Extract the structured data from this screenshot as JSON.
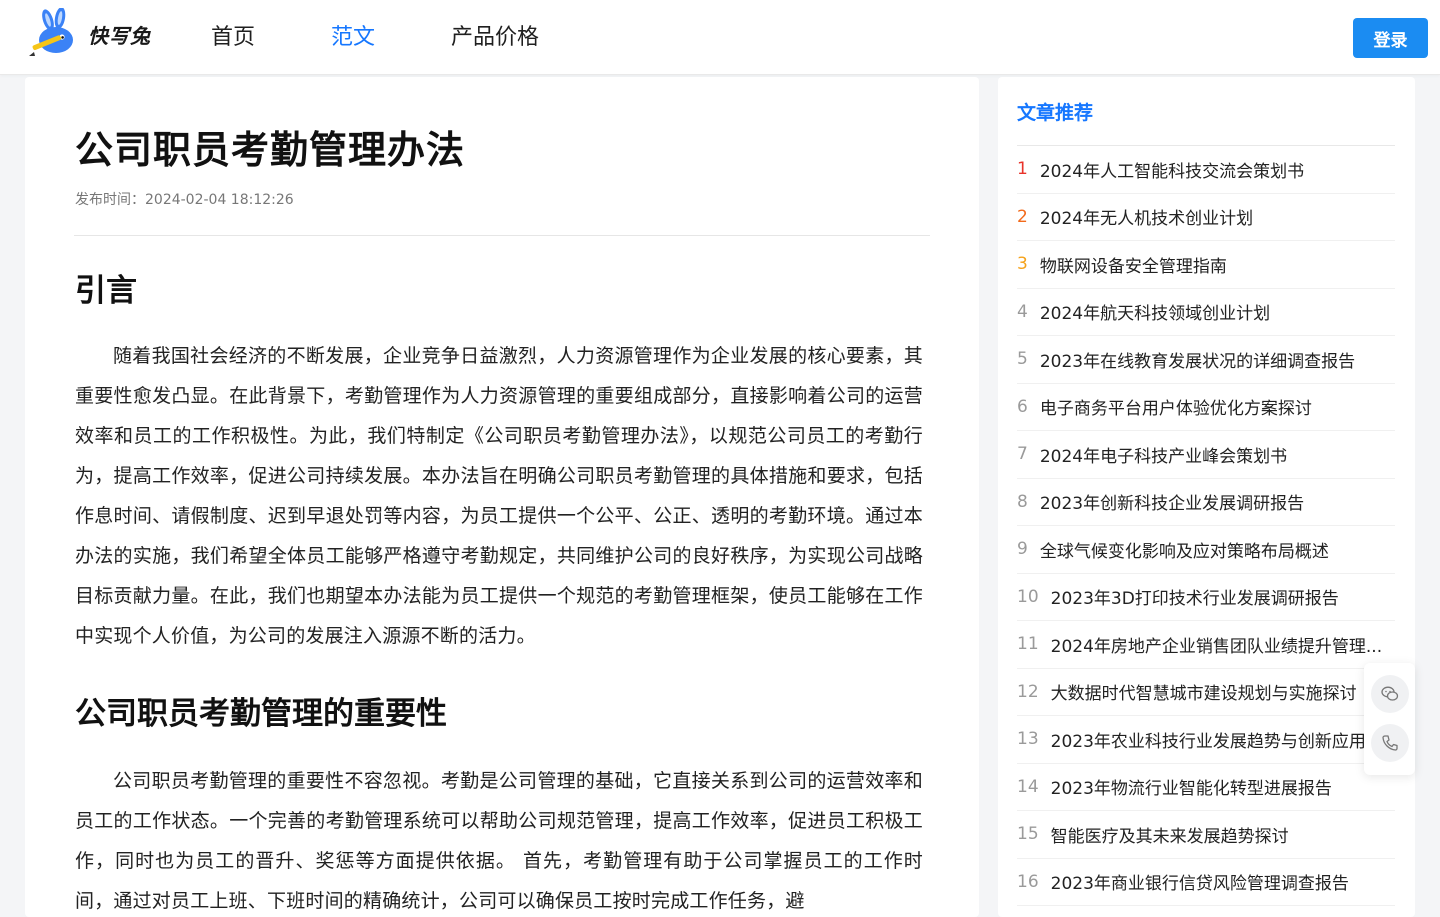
{
  "header": {
    "logo_text": "快写兔",
    "nav": [
      {
        "label": "首页",
        "active": false
      },
      {
        "label": "范文",
        "active": true
      },
      {
        "label": "产品价格",
        "active": false
      }
    ],
    "login_label": "登录",
    "accent_color": "#1677ff"
  },
  "article": {
    "title": "公司职员考勤管理办法",
    "publish_time": "发布时间：2024-02-04 18:12:26",
    "sections": [
      {
        "heading": "引言",
        "paragraph": "随着我国社会经济的不断发展，企业竞争日益激烈，人力资源管理作为企业发展的核心要素，其重要性愈发凸显。在此背景下，考勤管理作为人力资源管理的重要组成部分，直接影响着公司的运营效率和员工的工作积极性。为此，我们特制定《公司职员考勤管理办法》，以规范公司员工的考勤行为，提高工作效率，促进公司持续发展。本办法旨在明确公司职员考勤管理的具体措施和要求，包括作息时间、请假制度、迟到早退处罚等内容，为员工提供一个公平、公正、透明的考勤环境。通过本办法的实施，我们希望全体员工能够严格遵守考勤规定，共同维护公司的良好秩序，为实现公司战略目标贡献力量。在此，我们也期望本办法能为员工提供一个规范的考勤管理框架，使员工能够在工作中实现个人价值，为公司的发展注入源源不断的活力。"
      },
      {
        "heading": "公司职员考勤管理的重要性",
        "paragraph": "公司职员考勤管理的重要性不容忽视。考勤是公司管理的基础，它直接关系到公司的运营效率和员工的工作状态。一个完善的考勤管理系统可以帮助公司规范管理，提高工作效率，促进员工积极工作，同时也为员工的晋升、奖惩等方面提供依据。 首先，考勤管理有助于公司掌握员工的工作时间，通过对员工上班、下班时间的精确统计，公司可以确保员工按时完成工作任务，避"
      }
    ]
  },
  "sidebar": {
    "title": "文章推荐",
    "items": [
      {
        "num": "1",
        "title": "2024年人工智能科技交流会策划书"
      },
      {
        "num": "2",
        "title": "2024年无人机技术创业计划"
      },
      {
        "num": "3",
        "title": "物联网设备安全管理指南"
      },
      {
        "num": "4",
        "title": "2024年航天科技领域创业计划"
      },
      {
        "num": "5",
        "title": "2023年在线教育发展状况的详细调查报告"
      },
      {
        "num": "6",
        "title": "电子商务平台用户体验优化方案探讨"
      },
      {
        "num": "7",
        "title": "2024年电子科技产业峰会策划书"
      },
      {
        "num": "8",
        "title": "2023年创新科技企业发展调研报告"
      },
      {
        "num": "9",
        "title": "全球气候变化影响及应对策略布局概述"
      },
      {
        "num": "10",
        "title": "2023年3D打印技术行业发展调研报告"
      },
      {
        "num": "11",
        "title": "2024年房地产企业销售团队业绩提升管理..."
      },
      {
        "num": "12",
        "title": "大数据时代智慧城市建设规划与实施探讨"
      },
      {
        "num": "13",
        "title": "2023年农业科技行业发展趋势与创新应用"
      },
      {
        "num": "14",
        "title": "2023年物流行业智能化转型进展报告"
      },
      {
        "num": "15",
        "title": "智能医疗及其未来发展趋势探讨"
      },
      {
        "num": "16",
        "title": "2023年商业银行信贷风险管理调查报告"
      }
    ]
  },
  "float_icons": [
    "wechat-icon",
    "phone-icon"
  ]
}
